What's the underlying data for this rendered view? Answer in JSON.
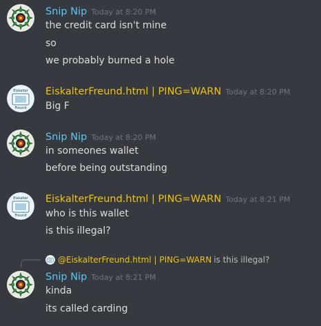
{
  "colors": {
    "background": "#36393f",
    "snip_name": "#5bc8f5",
    "eiskalter_name": "#f1c40f",
    "timestamp": "#72767d",
    "message_text": "#dcddde"
  },
  "icons": {
    "snip_avatar": "mandala-avatar-icon",
    "eiskalter_avatar": "eiskalter-freund-avatar-icon"
  },
  "groups": [
    {
      "author": "Snip Nip",
      "timestamp": "Today at 8:20 PM",
      "lines": [
        "the credit card isn't mine",
        "so",
        "we probably burned a hole"
      ]
    },
    {
      "author": "EiskalterFreund.html | PING=WARN",
      "timestamp": "Today at 8:20 PM",
      "lines": [
        "Big F"
      ]
    },
    {
      "author": "Snip Nip",
      "timestamp": "Today at 8:20 PM",
      "lines": [
        "in someones wallet",
        "before being outstanding"
      ]
    },
    {
      "author": "EiskalterFreund.html | PING=WARN",
      "timestamp": "Today at 8:21 PM",
      "lines": [
        "who is this wallet",
        "is this illegal?"
      ]
    },
    {
      "reply": {
        "mention": "@EiskalterFreund.html | PING=WARN",
        "text": "is this illegal?"
      },
      "author": "Snip Nip",
      "timestamp": "Today at 8:21 PM",
      "lines": [
        "kinda",
        "its called carding"
      ]
    }
  ],
  "avatar_text": {
    "line1": "Eiskalter",
    "line2": "Freund"
  }
}
